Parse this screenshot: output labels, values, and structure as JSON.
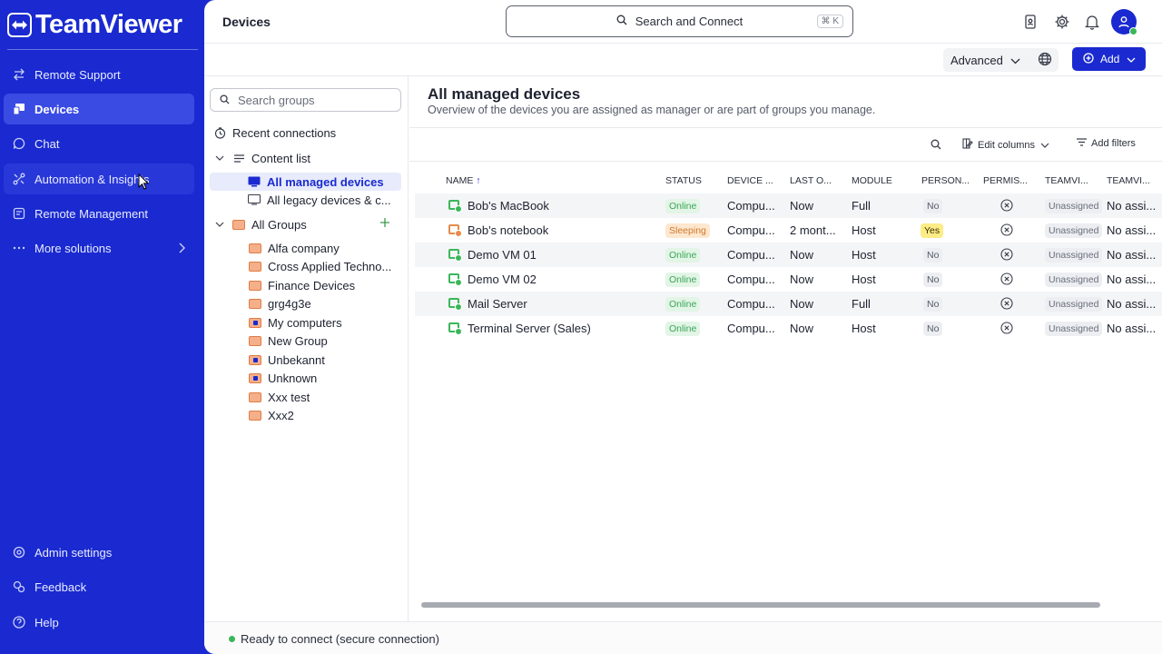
{
  "app": {
    "name": "TeamViewer"
  },
  "sidebar": {
    "items": [
      {
        "label": "Remote Support",
        "icon": "arrows-swap-icon"
      },
      {
        "label": "Devices",
        "icon": "devices-icon"
      },
      {
        "label": "Chat",
        "icon": "chat-icon"
      },
      {
        "label": "Automation & Insights",
        "icon": "automation-icon"
      },
      {
        "label": "Remote Management",
        "icon": "remote-management-icon"
      },
      {
        "label": "More solutions",
        "icon": "more-dots-icon"
      }
    ],
    "bottom": [
      {
        "label": "Admin settings",
        "icon": "admin-gear-icon"
      },
      {
        "label": "Feedback",
        "icon": "feedback-icon"
      },
      {
        "label": "Help",
        "icon": "help-icon"
      }
    ]
  },
  "header": {
    "title": "Devices",
    "search_label": "Search and Connect",
    "shortcut": "⌘ K"
  },
  "toolbar": {
    "advanced_label": "Advanced",
    "add_label": "Add"
  },
  "groups_panel": {
    "search_placeholder": "Search groups",
    "recent": "Recent connections",
    "content_list": "Content list",
    "all_managed": "All managed devices",
    "all_legacy": "All legacy devices & c...",
    "all_groups": "All Groups",
    "groups": [
      "Alfa company",
      "Cross Applied Techno...",
      "Finance Devices",
      "grg4g3e",
      "My computers",
      "New Group",
      "Unbekannt",
      "Unknown",
      "Xxx test",
      "Xxx2"
    ]
  },
  "content": {
    "title": "All managed devices",
    "subtitle": "Overview of the devices you are assigned as manager or are part of groups you manage.",
    "edit_columns": "Edit columns",
    "add_filters": "Add filters"
  },
  "table": {
    "columns": [
      "NAME",
      "STATUS",
      "DEVICE ...",
      "LAST O...",
      "MODULE",
      "PERSON...",
      "PERMIS...",
      "TEAMVI...",
      "TEAMVI..."
    ],
    "rows": [
      {
        "name": "Bob's MacBook",
        "status": "Online",
        "device": "Compu...",
        "last": "Now",
        "module": "Full",
        "personal": "No",
        "teamviewer1": "Unassigned",
        "teamviewer2": "No assi..."
      },
      {
        "name": "Bob's notebook",
        "status": "Sleeping",
        "device": "Compu...",
        "last": "2 mont...",
        "module": "Host",
        "personal": "Yes",
        "teamviewer1": "Unassigned",
        "teamviewer2": "No assi..."
      },
      {
        "name": "Demo VM 01",
        "status": "Online",
        "device": "Compu...",
        "last": "Now",
        "module": "Host",
        "personal": "No",
        "teamviewer1": "Unassigned",
        "teamviewer2": "No assi..."
      },
      {
        "name": "Demo VM 02",
        "status": "Online",
        "device": "Compu...",
        "last": "Now",
        "module": "Host",
        "personal": "No",
        "teamviewer1": "Unassigned",
        "teamviewer2": "No assi..."
      },
      {
        "name": "Mail Server",
        "status": "Online",
        "device": "Compu...",
        "last": "Now",
        "module": "Full",
        "personal": "No",
        "teamviewer1": "Unassigned",
        "teamviewer2": "No assi..."
      },
      {
        "name": "Terminal Server (Sales)",
        "status": "Online",
        "device": "Compu...",
        "last": "Now",
        "module": "Host",
        "personal": "No",
        "teamviewer1": "Unassigned",
        "teamviewer2": "No assi..."
      }
    ]
  },
  "status": {
    "text": "Ready to connect (secure connection)"
  },
  "colors": {
    "brand": "#1a2ad0",
    "online": "#3ab75a",
    "sleeping": "#e78a4a"
  }
}
